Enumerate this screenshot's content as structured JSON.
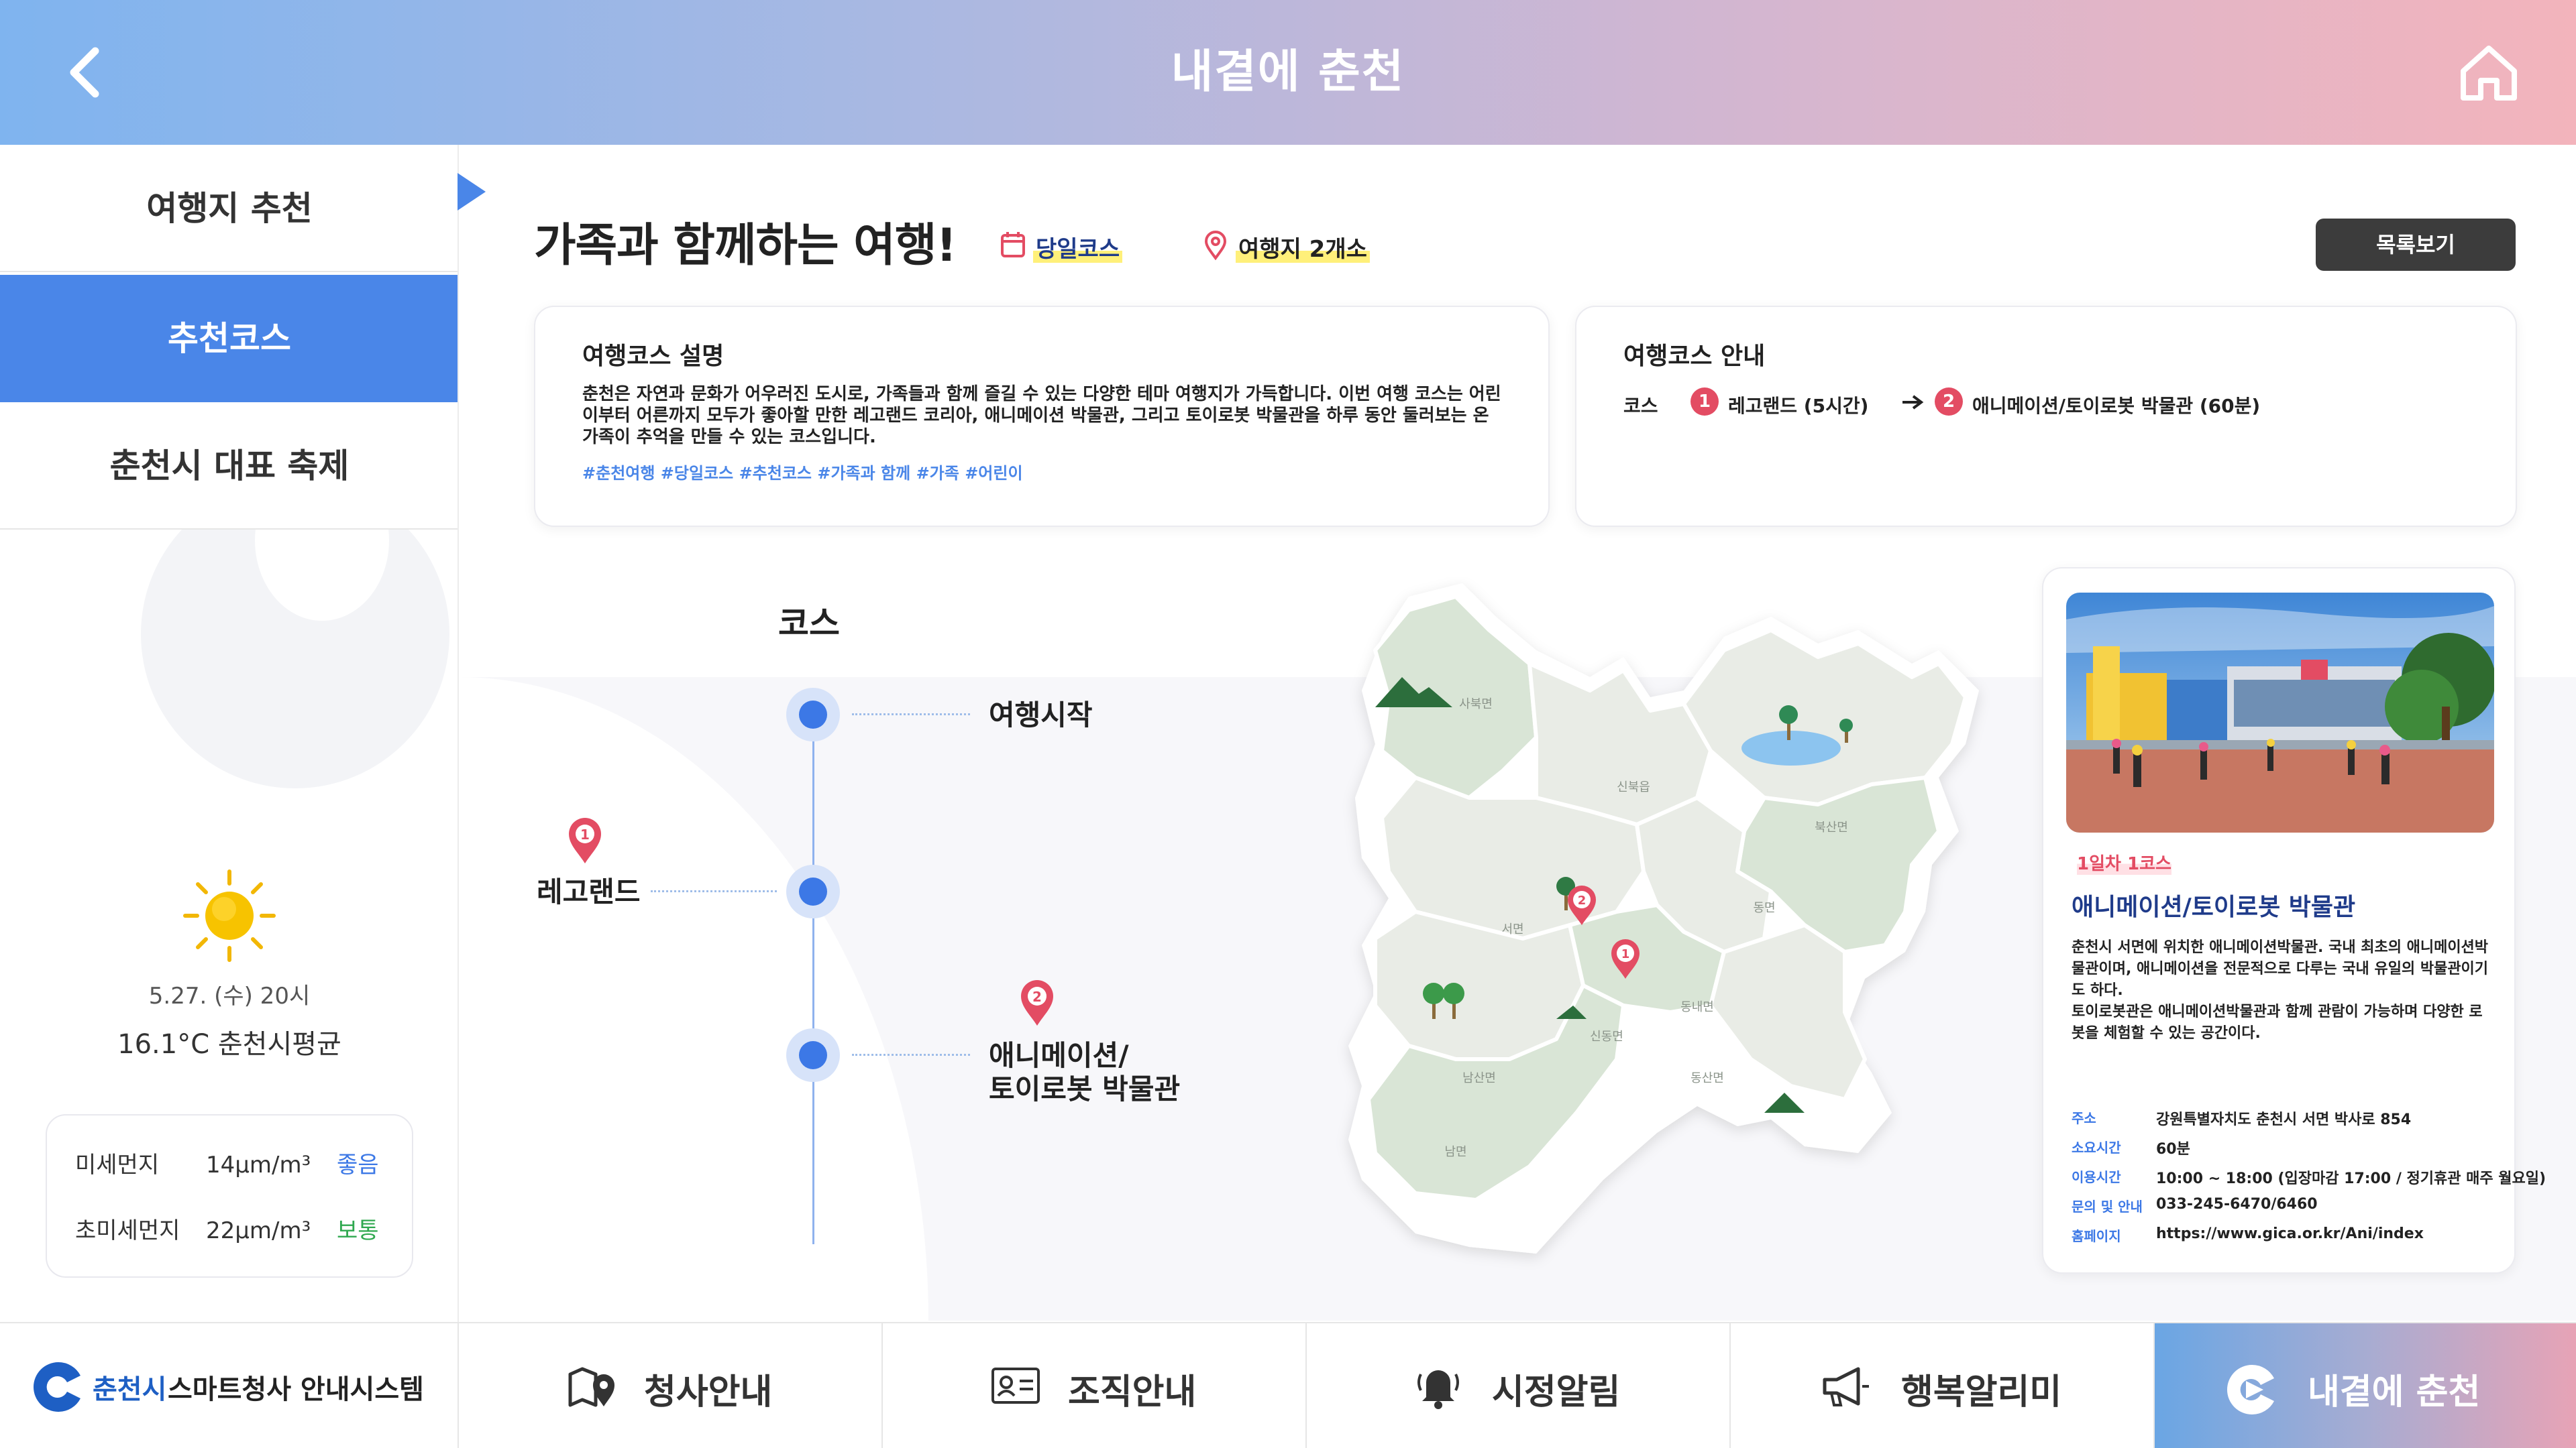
{
  "header": {
    "title": "내곁에 춘천",
    "back_icon": "chevron-left-icon",
    "home_icon": "home-icon"
  },
  "sidebar": {
    "items": [
      {
        "label": "여행지 추천",
        "active": false
      },
      {
        "label": "추천코스",
        "active": true
      },
      {
        "label": "춘천시 대표 축제",
        "active": false
      }
    ],
    "weather": {
      "icon": "sun-icon",
      "date": "5.27. (수) 20시",
      "temp": "16.1°C 춘천시평균"
    },
    "dust": [
      {
        "label": "미세먼지",
        "value": "14μm/m³",
        "grade": "좋음",
        "grade_color": "#3c78e6"
      },
      {
        "label": "초미세먼지",
        "value": "22μm/m³",
        "grade": "보통",
        "grade_color": "#2fa84f"
      }
    ]
  },
  "main": {
    "title": "가족과 함께하는 여행!",
    "duration": "당일코스",
    "spot_count": "여행지 2개소",
    "list_button": "목록보기",
    "description": {
      "title": "여행코스 설명",
      "text": "춘천은 자연과 문화가 어우러진 도시로, 가족들과 함께 즐길 수 있는 다양한 테마 여행지가 가득합니다. 이번 여행 코스는 어린이부터 어른까지 모두가 좋아할 만한 레고랜드 코리아, 애니메이션 박물관, 그리고 토이로봇 박물관을 하루 동안 둘러보는 온 가족이 추억을 만들 수 있는 코스입니다.",
      "tags": "#춘천여행 #당일코스 #추천코스 #가족과 함께 #가족 #어린이"
    },
    "guide": {
      "title": "여행코스 안내",
      "course_label": "코스",
      "stops": [
        {
          "num": "1",
          "name": "레고랜드 (5시간)"
        },
        {
          "num": "2",
          "name": "애니메이션/토이로봇 박물관 (60분)"
        }
      ]
    },
    "timeline": {
      "heading": "코스",
      "start": "여행시작",
      "stop1_num": "1",
      "stop1": "레고랜드",
      "stop2_num": "2",
      "stop2_line1": "애니메이션/",
      "stop2_line2": "토이로봇 박물관"
    },
    "map": {
      "regions": [
        "사북면",
        "신북읍",
        "북산면",
        "동면",
        "서면",
        "동내면",
        "신동면",
        "남산면",
        "동산면",
        "남면"
      ],
      "pins": [
        "1",
        "2"
      ]
    },
    "info": {
      "tag": "1일차 1코스",
      "name": "애니메이션/토이로봇 박물관",
      "desc": "춘천시 서면에 위치한 애니메이션박물관. 국내 최초의 애니메이션박물관이며, 애니메이션을 전문적으로 다루는 국내 유일의 박물관이기도 하다.\n토이로봇관은 애니메이션박물관과 함께 관람이 가능하며 다양한 로봇을 체험할 수 있는 공간이다.",
      "rows": [
        {
          "k": "주소",
          "v": "강원특별자치도 춘천시 서면 박사로 854"
        },
        {
          "k": "소요시간",
          "v": "60분"
        },
        {
          "k": "이용시간",
          "v": "10:00 ~ 18:00 (입장마감 17:00 / 정기휴관 매주 월요일)"
        },
        {
          "k": "문의 및 안내",
          "v": "033-245-6470/6460"
        },
        {
          "k": "홈페이지",
          "v": "https://www.gica.or.kr/Ani/index"
        }
      ]
    }
  },
  "bottom_nav": {
    "brand_city": "춘천시",
    "brand_system": "스마트청사 안내시스템",
    "items": [
      {
        "label": "청사안내",
        "icon": "map-pin-icon"
      },
      {
        "label": "조직안내",
        "icon": "id-card-icon"
      },
      {
        "label": "시정알림",
        "icon": "bell-icon"
      },
      {
        "label": "행복알리미",
        "icon": "megaphone-icon"
      },
      {
        "label": "내곁에 춘천",
        "icon": "chuncheon-logo-icon",
        "active": true
      }
    ]
  },
  "colors": {
    "accent": "#4a86e8",
    "pin": "#e34c63",
    "dark_button": "#3c3c3c"
  }
}
